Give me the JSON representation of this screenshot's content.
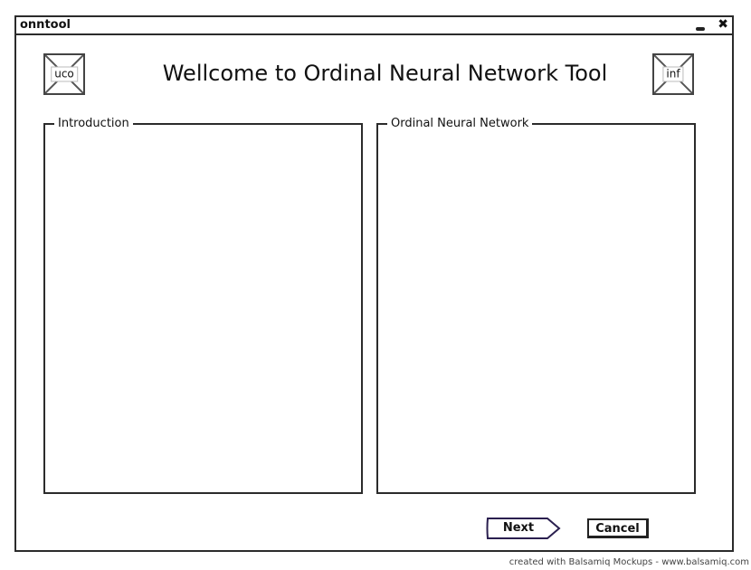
{
  "window": {
    "title": "onntool",
    "controls": {
      "minimize_icon": "minimize-icon",
      "close_icon": "close-icon",
      "close_glyph": "✖"
    }
  },
  "header": {
    "left_image_label": "uco",
    "right_image_label": "inf",
    "title": "Wellcome to Ordinal Neural Network Tool"
  },
  "panels": {
    "introduction_label": "Introduction",
    "onn_label": "Ordinal Neural Network"
  },
  "footer": {
    "next_label": "Next",
    "cancel_label": "Cancel"
  },
  "watermark": "created with Balsamiq Mockups - www.balsamiq.com",
  "colors": {
    "border": "#2b2b2b",
    "next_border": "#2a1f4f",
    "background": "#ffffff"
  }
}
